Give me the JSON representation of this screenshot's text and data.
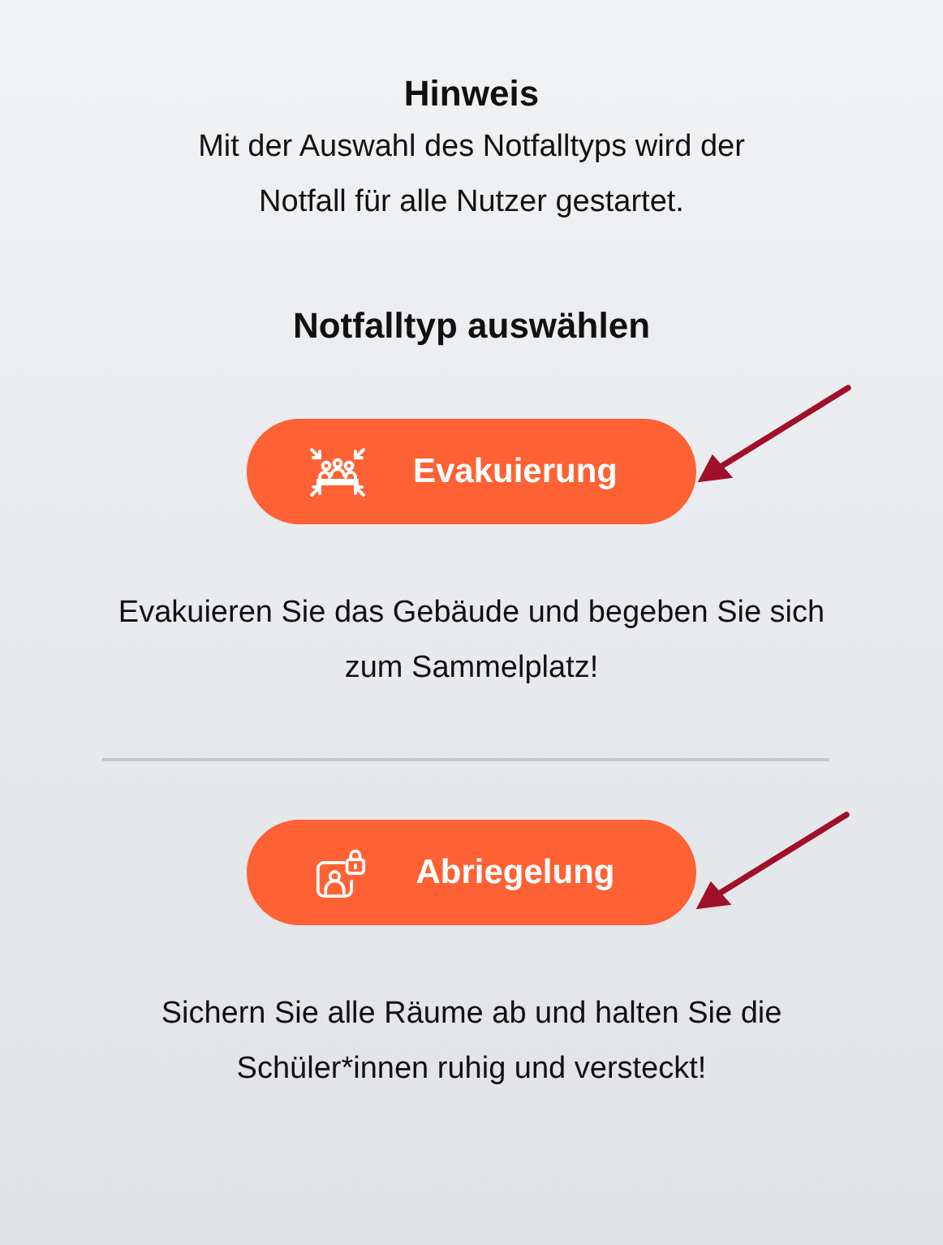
{
  "notice": {
    "title": "Hinweis",
    "text": "Mit der Auswahl des Notfalltyps wird der Notfall für alle Nutzer gestartet."
  },
  "section_title": "Notfalltyp auswählen",
  "options": [
    {
      "kind": "evacuation",
      "label": "Evakuierung",
      "description": "Evakuieren Sie das Gebäude und begeben Sie sich zum Sammelplatz!"
    },
    {
      "kind": "lockdown",
      "label": "Abriegelung",
      "description": "Sichern Sie alle Räume ab und halten Sie die Schüler*innen ruhig und versteckt!"
    }
  ]
}
